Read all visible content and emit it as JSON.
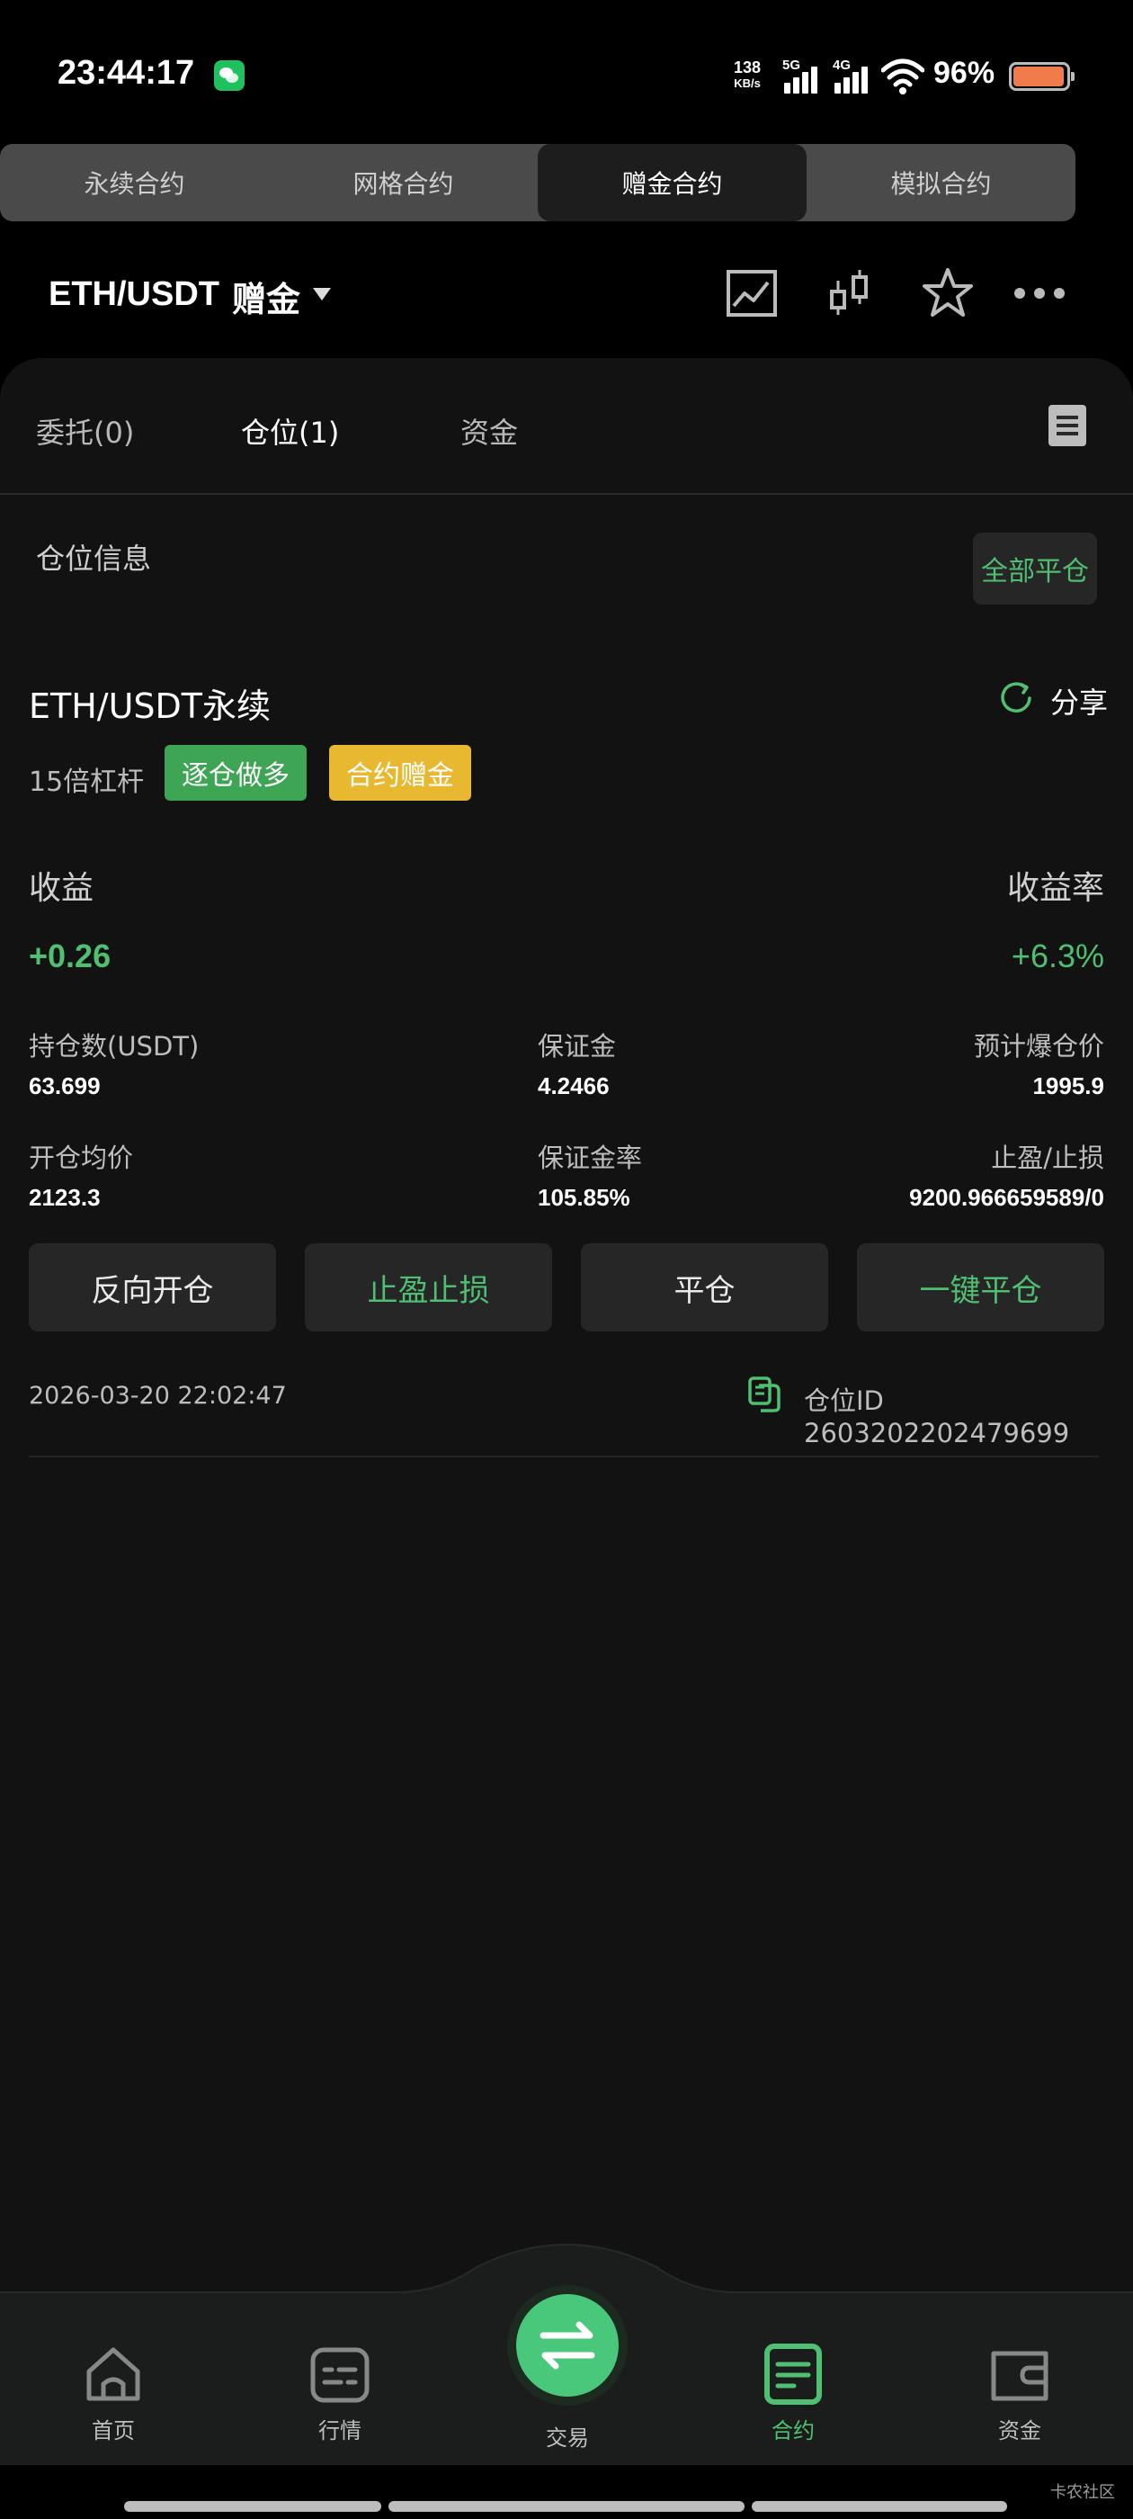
{
  "status_bar": {
    "time": "23:44:17",
    "net_speed_value": "138",
    "net_speed_unit": "KB/s",
    "signal1_label": "5G",
    "signal2_label": "4G",
    "battery_percent": "96%",
    "battery_level": 0.96,
    "battery_color": "#ef7c4a",
    "notification_icon": "wechat-icon"
  },
  "contract_tabs": [
    {
      "label": "永续合约",
      "active": false
    },
    {
      "label": "网格合约",
      "active": false
    },
    {
      "label": "赠金合约",
      "active": true
    },
    {
      "label": "模拟合约",
      "active": false
    }
  ],
  "header": {
    "pair": "ETH/USDT",
    "tag": "赠金",
    "icons": [
      "chart-line-icon",
      "candlestick-icon",
      "star-icon",
      "more-icon"
    ]
  },
  "sub_tabs": [
    {
      "label": "委托(0)",
      "active": false
    },
    {
      "label": "仓位(1)",
      "active": true
    },
    {
      "label": "资金",
      "active": false
    }
  ],
  "position_section": {
    "title": "仓位信息",
    "close_all_label": "全部平仓"
  },
  "position": {
    "title": "ETH/USDT永续",
    "share_label": "分享",
    "leverage": "15倍杠杆",
    "badge_direction": "逐仓做多",
    "badge_bonus": "合约赠金",
    "pnl_label": "收益",
    "pnl_value": "+0.26",
    "roe_label": "收益率",
    "roe_value": "+6.3%",
    "size_label": "持仓数(USDT)",
    "size_value": "63.699",
    "margin_label": "保证金",
    "margin_value": "4.2466",
    "liq_label": "预计爆仓价",
    "liq_value": "1995.9",
    "entry_label": "开仓均价",
    "entry_value": "2123.3",
    "margin_ratio_label": "保证金率",
    "margin_ratio_value": "105.85%",
    "tpsl_label": "止盈/止损",
    "tpsl_value": "9200.966659589/0",
    "actions": [
      "反向开仓",
      "止盈止损",
      "平仓",
      "一键平仓"
    ],
    "open_time": "2026-03-20 22:02:47",
    "position_id": "仓位ID 2603202202479699"
  },
  "bottom_nav": [
    {
      "label": "首页",
      "icon": "home-icon",
      "active": false
    },
    {
      "label": "行情",
      "icon": "market-icon",
      "active": false
    },
    {
      "label": "交易",
      "icon": "swap-icon",
      "active": false
    },
    {
      "label": "合约",
      "icon": "contract-icon",
      "active": true
    },
    {
      "label": "资金",
      "icon": "wallet-icon",
      "active": false
    }
  ],
  "watermark": "卡农社区",
  "colors": {
    "accent_green": "#4fbf71",
    "badge_green": "#3ea555",
    "badge_yellow": "#e8b830",
    "panel_bg": "#121212"
  }
}
